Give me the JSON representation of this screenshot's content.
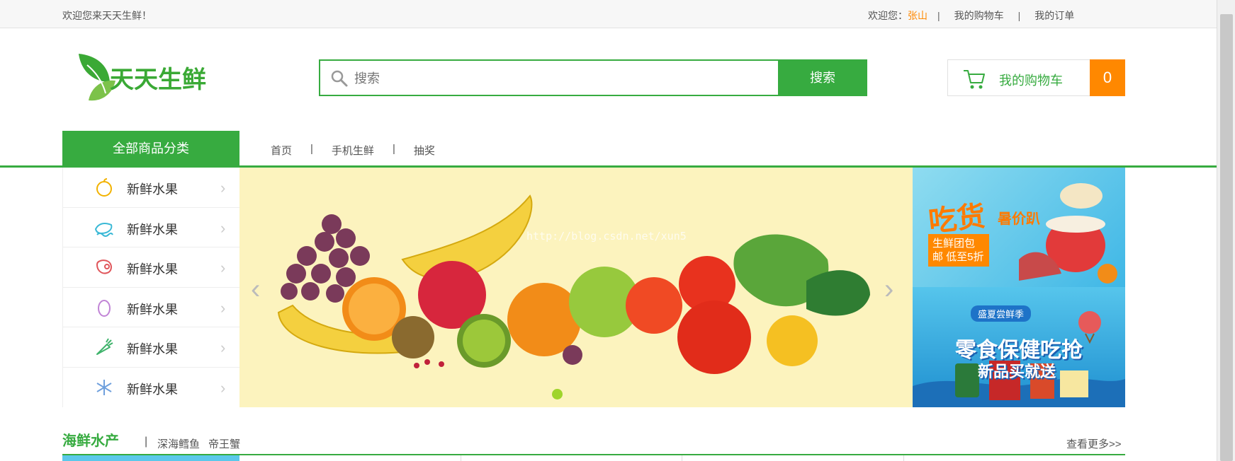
{
  "topbar": {
    "welcome": "欢迎您来天天生鲜！",
    "greeting": "欢迎您：",
    "user": "张山",
    "sep": "|",
    "cart_link": "我的购物车",
    "orders_link": "我的订单"
  },
  "header": {
    "logo_text": "天天生鲜",
    "search_placeholder": "搜索",
    "search_button": "搜索",
    "cart_label": "我的购物车",
    "cart_count": "0"
  },
  "nav": {
    "all_categories": "全部商品分类",
    "links": [
      "首页",
      "手机生鲜",
      "抽奖"
    ],
    "sep": "|"
  },
  "categories": [
    {
      "label": "新鲜水果",
      "icon": "apple-icon"
    },
    {
      "label": "新鲜水果",
      "icon": "seafood-icon"
    },
    {
      "label": "新鲜水果",
      "icon": "meat-icon"
    },
    {
      "label": "新鲜水果",
      "icon": "egg-icon"
    },
    {
      "label": "新鲜水果",
      "icon": "carrot-icon"
    },
    {
      "label": "新鲜水果",
      "icon": "snowflake-icon"
    }
  ],
  "banner": {
    "watermark": "http://blog.csdn.net/xun5",
    "prev": "‹",
    "next": "›"
  },
  "ads": {
    "ad1": {
      "title": "吃货",
      "subtitle": "暑价趴",
      "promo": "生鲜团包邮 低至5折"
    },
    "ad2": {
      "badge": "盛夏尝鲜季",
      "line1": "零食保健吃抢",
      "line2": "新品买就送"
    }
  },
  "section": {
    "title": "海鲜水产",
    "sep": "|",
    "tags": [
      "深海鳕鱼",
      "帝王蟹"
    ],
    "more": "查看更多>>"
  },
  "colors": {
    "accent": "#37ab40",
    "orange": "#ff8800"
  }
}
